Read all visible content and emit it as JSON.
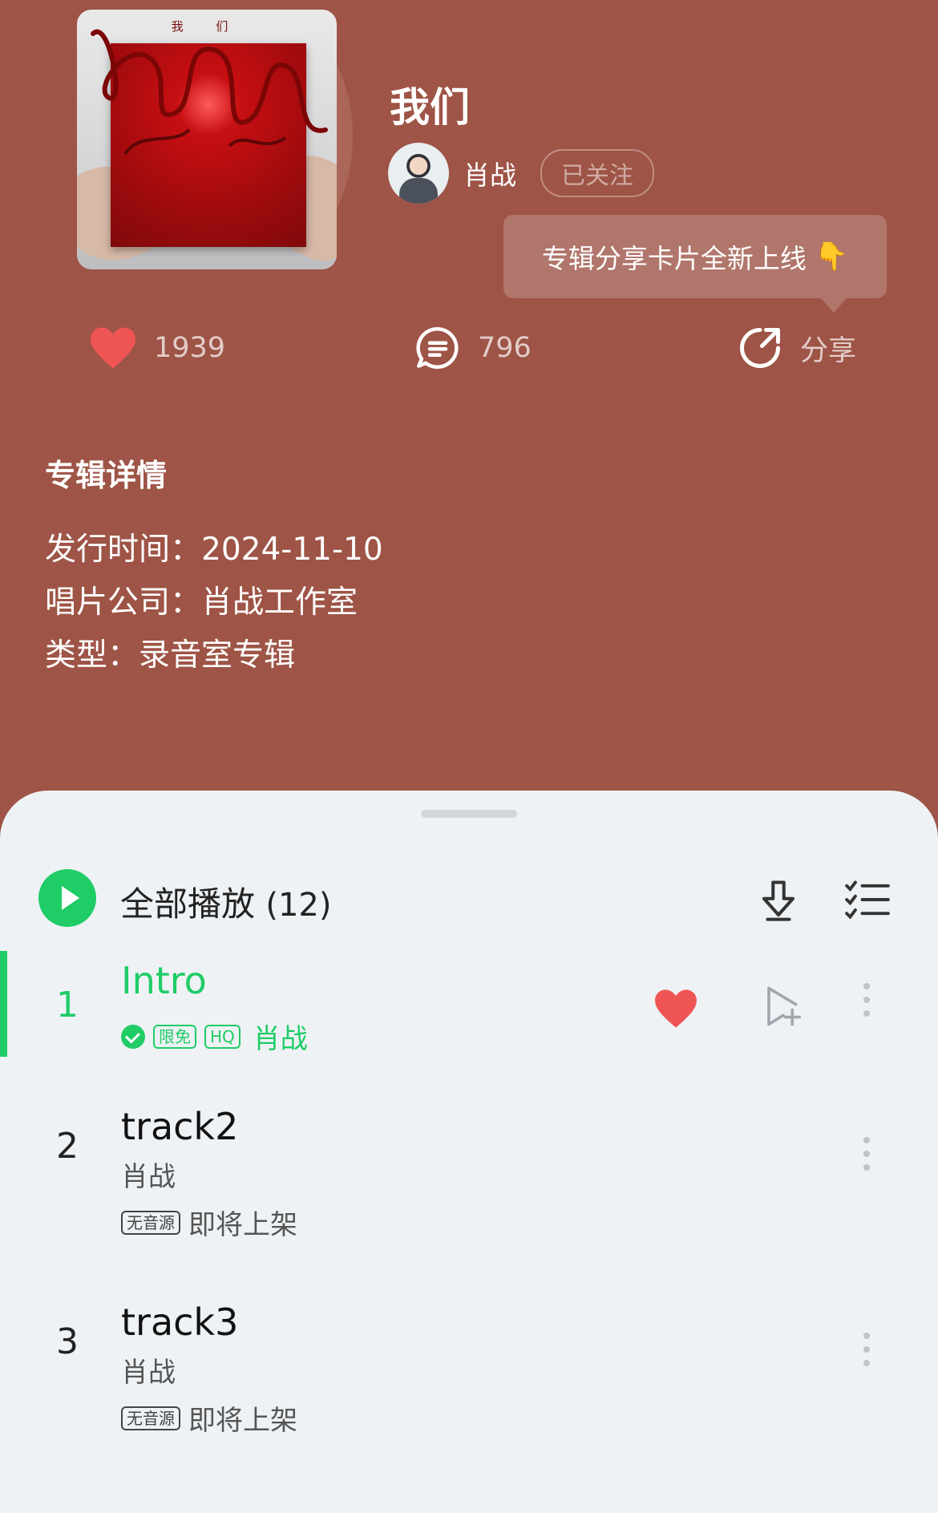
{
  "album": {
    "cover_text": "我 们",
    "title": "我们",
    "artist": "肖战",
    "follow_status": "已关注"
  },
  "tooltip": {
    "text": "专辑分享卡片全新上线",
    "icon": "pointing-down-hand-icon"
  },
  "stats": {
    "likes": "1939",
    "comments": "796",
    "share_label": "分享"
  },
  "details": {
    "heading": "专辑详情",
    "release": "发行时间：2024-11-10",
    "label": "唱片公司：肖战工作室",
    "type": "类型：录音室专辑"
  },
  "tracklist": {
    "play_all_label": "全部播放",
    "count": "(12)",
    "tracks": [
      {
        "num": "1",
        "title": "Intro",
        "tag1": "限免",
        "tag2": "HQ",
        "artist": "肖战"
      },
      {
        "num": "2",
        "title": "track2",
        "artist": "肖战",
        "tag": "无音源",
        "status": "即将上架"
      },
      {
        "num": "3",
        "title": "track3",
        "artist": "肖战",
        "tag": "无音源",
        "status": "即将上架"
      }
    ]
  },
  "colors": {
    "background": "#9e5446",
    "accent": "#1fcc66",
    "like_red": "#f05555"
  }
}
